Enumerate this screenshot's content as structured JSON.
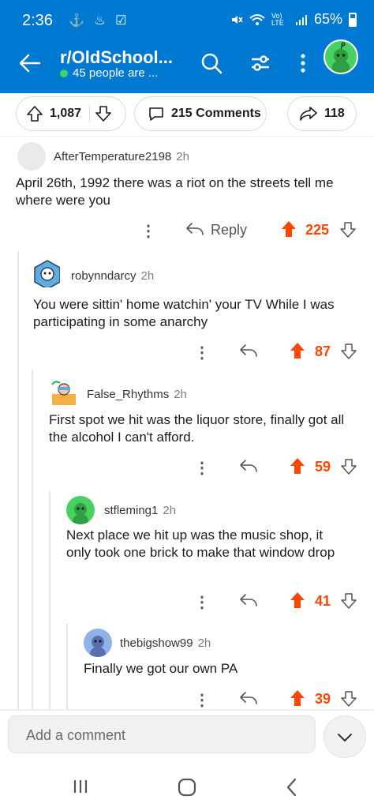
{
  "status": {
    "time": "2:36",
    "icons_left": "⚓ ♨ ☑",
    "battery": "65%",
    "signal": "Vo) LTE"
  },
  "header": {
    "subreddit": "r/OldSchool...",
    "online": "45 people are ..."
  },
  "post_actions": {
    "votes": "1,087",
    "comments": "215 Comments",
    "shares": "118"
  },
  "comments": [
    {
      "user": "AfterTemperature2198",
      "ago": "2h",
      "body": "April 26th, 1992 there was a riot on the streets tell me where were you",
      "reply": "Reply",
      "score": "225"
    },
    {
      "user": "robynndarcy",
      "ago": "2h",
      "body": "You were sittin' home watchin' your TV While I was participating in some anarchy",
      "score": "87"
    },
    {
      "user": "False_Rhythms",
      "ago": "2h",
      "body": "First spot we hit was the liquor store, finally got all the alcohol I can't afford.",
      "score": "59"
    },
    {
      "user": "stfleming1",
      "ago": "2h",
      "body": "Next place we hit up was the music shop, it only took one brick to make that window drop",
      "score": "41"
    },
    {
      "user": "thebigshow99",
      "ago": "2h",
      "body": "Finally we got our own PA",
      "score": "39"
    }
  ],
  "composer": {
    "placeholder": "Add a comment"
  },
  "colors": {
    "header_bg": "#0079d3",
    "upvote": "#ff4500",
    "online": "#46d160"
  }
}
